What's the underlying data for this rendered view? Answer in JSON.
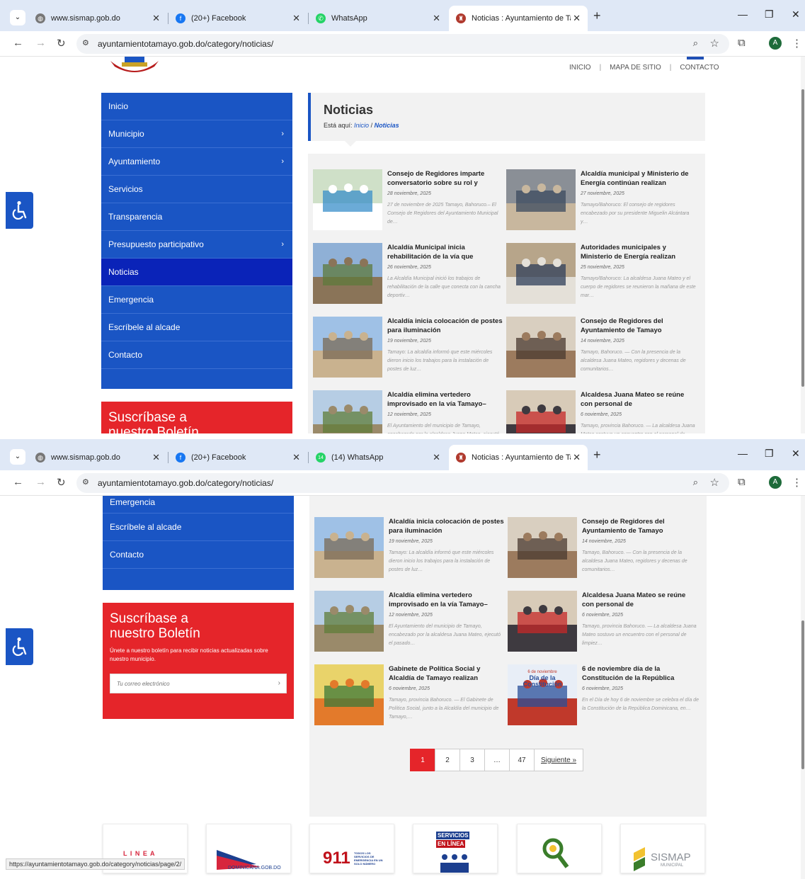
{
  "browser": {
    "tabs": [
      {
        "title": "www.sismap.gob.do",
        "color": "#777777",
        "glyph": "◍"
      },
      {
        "title": "(20+) Facebook",
        "color": "#1877f2",
        "glyph": "f"
      },
      {
        "title": "WhatsApp",
        "color": "#25d366",
        "glyph": "✆"
      },
      {
        "title": "Noticias : Ayuntamiento de Tam",
        "color": "#b03a2e",
        "glyph": "♜"
      }
    ],
    "tabs_bottom": [
      {
        "title": "www.sismap.gob.do",
        "color": "#777777",
        "glyph": "◍"
      },
      {
        "title": "(20+) Facebook",
        "color": "#1877f2",
        "glyph": "f"
      },
      {
        "title": "(14) WhatsApp",
        "color": "#25d366",
        "glyph": "14"
      },
      {
        "title": "Noticias : Ayuntamiento de Tam",
        "color": "#b03a2e",
        "glyph": "♜"
      }
    ],
    "url": "ayuntamientotamayo.gob.do/category/noticias/",
    "profile_initial": "A",
    "status_url": "https://ayuntamientotamayo.gob.do/category/noticias/page/2/"
  },
  "topnav": {
    "inicio": "INICIO",
    "mapa": "MAPA DE SITIO",
    "contacto": "CONTACTO"
  },
  "sidebar": {
    "items": [
      {
        "label": "Inicio",
        "chevron": "",
        "active": false
      },
      {
        "label": "Municipio",
        "chevron": "›",
        "active": false
      },
      {
        "label": "Ayuntamiento",
        "chevron": "›",
        "active": false
      },
      {
        "label": "Servicios",
        "chevron": "",
        "active": false
      },
      {
        "label": "Transparencia",
        "chevron": "",
        "active": false
      },
      {
        "label": "Presupuesto participativo",
        "chevron": "›",
        "active": false
      },
      {
        "label": "Noticias",
        "chevron": "",
        "active": true
      },
      {
        "label": "Emergencia",
        "chevron": "",
        "active": false
      },
      {
        "label": "Escríbele al alcade",
        "chevron": "",
        "active": false
      },
      {
        "label": "Contacto",
        "chevron": "",
        "active": false
      }
    ]
  },
  "subscribe": {
    "title_line1": "Suscríbase a",
    "title_line2": "nuestro Boletín",
    "text": "Únete a nuestro boletín para recibir noticias actualizadas sobre nuestro municipio.",
    "placeholder": "Tu correo electrónico",
    "arrow": "›"
  },
  "header": {
    "title": "Noticias",
    "breadcrumb_prefix": "Está aquí:",
    "breadcrumb_home": "Inicio",
    "breadcrumb_sep": "/",
    "breadcrumb_current": "Noticias"
  },
  "posts": [
    {
      "title": "Consejo de Regidores imparte conversatorio sobre su rol y",
      "date": "28 noviembre, 2025",
      "excerpt": "27 de noviembre de 2025 Tamayo, Bahoruco.– El Consejo de Regidores del Ayuntamiento Municipal de…",
      "thumb": [
        "#cfe0c8",
        "#3a8fc9",
        "#ffffff"
      ]
    },
    {
      "title": "Alcaldía municipal y Ministerio de Energía continúan realizan",
      "date": "27 noviembre, 2025",
      "excerpt": "Tamayo/Bahoruco: El consejo de regidores encabezado por su presidente Miguelin Alcántara y…",
      "thumb": [
        "#8a8f96",
        "#3b4a5e",
        "#c8b79e"
      ]
    },
    {
      "title": "Alcaldía Municipal inicia rehabilitación de la vía que",
      "date": "26 noviembre, 2025",
      "excerpt": "La Alcaldía Municipal inició los trabajos de rehabilitación de la calle que conecta con la cancha deportiv…",
      "thumb": [
        "#8fb0d6",
        "#5d7a3b",
        "#8a7458"
      ]
    },
    {
      "title": "Autoridades municipales y Ministerio de Energía realizan",
      "date": "25 noviembre, 2025",
      "excerpt": "Tamayo/Bahoruco: La alcaldesa Juana Mateo y el cuerpo de regidores se reunieron la mañana de este mar…",
      "thumb": [
        "#b7a58a",
        "#2f3f5a",
        "#e4e0d8"
      ]
    },
    {
      "title": "Alcaldía inicia colocación de postes para iluminación",
      "date": "19 noviembre, 2025",
      "excerpt": "Tamayo: La alcaldía informó que este miércoles dieron inicio los trabajos para la instalación de postes de luz…",
      "thumb": [
        "#9fc1e6",
        "#7a6a55",
        "#c9b28f"
      ]
    },
    {
      "title": "Consejo de Regidores del Ayuntamiento de Tamayo",
      "date": "14 noviembre, 2025",
      "excerpt": "Tamayo, Bahoruco. — Con la presencia de la alcaldesa Juana Mateo, regidores y decenas de comunitarios…",
      "thumb": [
        "#d9cfc0",
        "#4a3a30",
        "#9c7b5e"
      ]
    },
    {
      "title": "Alcaldía elimina vertedero improvisado en la vía Tamayo–",
      "date": "12 noviembre, 2025",
      "excerpt": "El Ayuntamiento del municipio de Tamayo, encabezado por la alcaldesa Juana Mateo, ejecutó el pasado…",
      "thumb": [
        "#b6cde4",
        "#5f7c3a",
        "#9a8a6a"
      ]
    },
    {
      "title": "Alcaldesa Juana Mateo se reúne con personal de",
      "date": "6 noviembre, 2025",
      "excerpt": "Tamayo, provincia Bahoruco. — La alcaldesa Juana Mateo sostuvo un encuentro con el personal de limpiez…",
      "thumb": [
        "#d8cbb8",
        "#c62828",
        "#3e3a40"
      ]
    },
    {
      "title": "Gabinete de Política Social y Alcaldía de Tamayo realizan",
      "date": "6 noviembre, 2025",
      "excerpt": "Tamayo, provincia Bahoruco. — El Gabinete de Política Social, junto a la Alcaldía del municipio de Tamayo,…",
      "thumb": [
        "#e9d36a",
        "#3d7a3a",
        "#e37a2b"
      ]
    },
    {
      "title": "6 de noviembre día de la Constitución de la República",
      "date": "6 noviembre, 2025",
      "excerpt": "En el Día de hoy 6 de noviembre se celebra el día de la Constitución de la República Dominicana, en…",
      "thumb": [
        "#e8eef7",
        "#2a4f9a",
        "#c0392b"
      ],
      "overlay": {
        "small": "6 de noviembre",
        "big1": "Día de la",
        "big2": "Constitución"
      }
    }
  ],
  "pagination": [
    "1",
    "2",
    "3",
    "…",
    "47",
    "Siguiente »"
  ],
  "banners": [
    {
      "text": "L I N E A",
      "color": "#d7263d"
    },
    {
      "text": "DOMINICANA.GOB.DO",
      "color": "#1c3f8f"
    },
    {
      "text": "911",
      "small": "TODOS LOS SERVICIOS DE EMERGENCIA EN UN SOLO NÚMERO",
      "color": "#c0121b"
    },
    {
      "text": "SERVICIOS",
      "small": "EN LÍNEA",
      "color": "#c0121b"
    },
    {
      "text": "",
      "color": "#3a7d2a"
    },
    {
      "text": "SISMAP",
      "small": "MUNICIPAL",
      "color": "#8a8f96"
    }
  ]
}
